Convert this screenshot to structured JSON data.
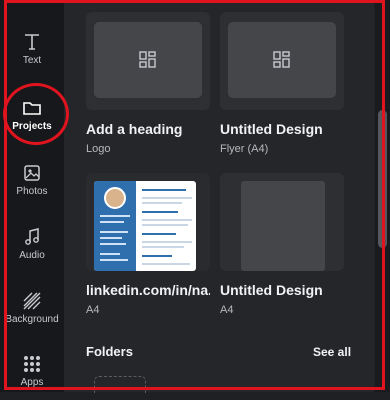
{
  "sidebar": {
    "items": [
      {
        "label": "Text",
        "icon": "text-icon"
      },
      {
        "label": "Projects",
        "icon": "folder-icon"
      },
      {
        "label": "Photos",
        "icon": "photo-icon"
      },
      {
        "label": "Audio",
        "icon": "music-icon"
      },
      {
        "label": "Background",
        "icon": "background-icon"
      },
      {
        "label": "Apps",
        "icon": "apps-grid-icon"
      }
    ],
    "active": "Projects"
  },
  "designs": [
    {
      "title": "Add a heading",
      "subtitle": "Logo"
    },
    {
      "title": "Untitled Design",
      "subtitle": "Flyer (A4)"
    },
    {
      "title": "linkedin.com/in/na...",
      "subtitle": "A4"
    },
    {
      "title": "Untitled Design",
      "subtitle": "A4"
    }
  ],
  "folders": {
    "title": "Folders",
    "see_all": "See all"
  },
  "colors": {
    "accent_annotation": "#e0141e",
    "background": "#252629",
    "sidebar": "#17181b"
  }
}
